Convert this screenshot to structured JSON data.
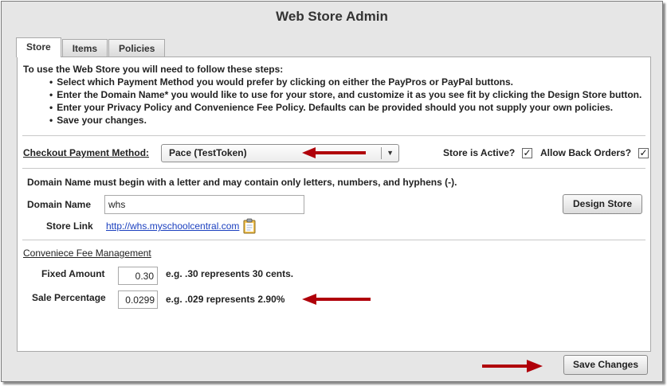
{
  "window": {
    "title": "Web Store Admin"
  },
  "tabs": [
    {
      "label": "Store",
      "active": true
    },
    {
      "label": "Items",
      "active": false
    },
    {
      "label": "Policies",
      "active": false
    }
  ],
  "instructions": {
    "intro": "To use the Web Store you will need to follow these steps:",
    "steps": [
      "Select which Payment Method you would prefer by clicking on either the PayPros or PayPal buttons.",
      "Enter the Domain Name* you would like to use for your store, and customize it as you see fit by clicking the Design Store button.",
      "Enter your Privacy Policy and Convenience Fee Policy. Defaults can be provided should you not supply your own policies.",
      "Save your changes."
    ]
  },
  "checkout": {
    "label": "Checkout Payment Method:",
    "selected": "Pace (TestToken)",
    "store_active_label": "Store is Active?",
    "store_active_checked": true,
    "back_orders_label": "Allow Back Orders?",
    "back_orders_checked": true
  },
  "domain": {
    "rule_text": "Domain Name must begin with a letter and may contain only letters, numbers, and hyphens (-).",
    "name_label": "Domain Name",
    "name_value": "whs",
    "store_link_label": "Store Link",
    "store_link_url": "http://whs.myschoolcentral.com",
    "design_button": "Design Store"
  },
  "fees": {
    "heading": "Conveniece Fee Management",
    "fixed_label": "Fixed Amount",
    "fixed_value": "0.30",
    "fixed_hint": "e.g. .30 represents 30 cents.",
    "percent_label": "Sale Percentage",
    "percent_value": "0.0299",
    "percent_hint": "e.g. .029 represents 2.90%"
  },
  "footer": {
    "save_button": "Save Changes"
  },
  "colors": {
    "arrow": "#b0000a",
    "link": "#1a3fbf",
    "window_bg": "#e6e6e6"
  }
}
